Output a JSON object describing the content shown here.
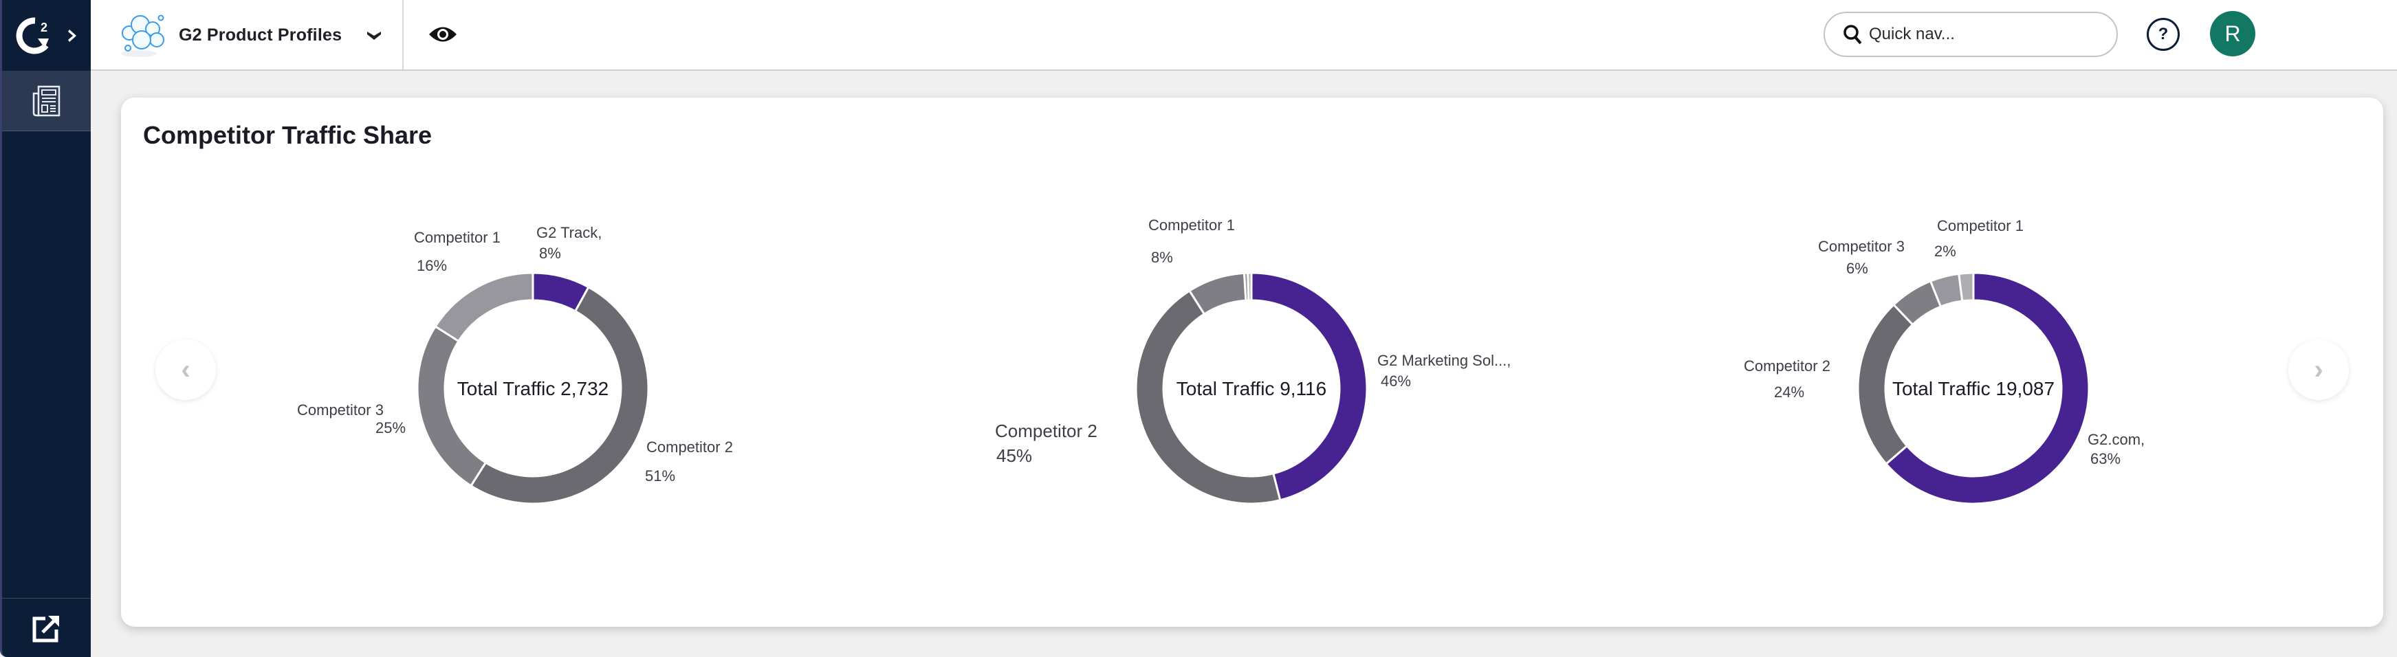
{
  "sidebar": {
    "logo_label": "G2",
    "expand_icon": "chevron-right-icon",
    "nav_items": [
      {
        "id": "reports",
        "icon": "newspaper-icon",
        "active": true
      }
    ],
    "footer_icon": "external-link-icon"
  },
  "header": {
    "product_name": "G2 Product Profiles",
    "product_icon": "cloud-logo-icon",
    "dropdown_icon": "chevron-down-icon",
    "view_icon": "eye-icon",
    "quick_nav_placeholder": "Quick nav...",
    "help_label": "?",
    "avatar_initial": "R"
  },
  "card": {
    "title": "Competitor Traffic Share",
    "prev_label": "‹",
    "next_label": "›"
  },
  "colors": {
    "brand_purple": "#472391",
    "competitor_dark": "#6b6a71",
    "competitor_mid": "#7f7e85",
    "competitor_light": "#98979d",
    "competitor_lighter": "#aeadb2",
    "avatar": "#127864",
    "sidebar": "#0c1e37"
  },
  "chart_data": [
    {
      "type": "pie",
      "variant": "donut",
      "center_label": "Total Traffic 2,732",
      "total": 2732,
      "slices": [
        {
          "name": "G2 Track,",
          "percent": 8,
          "label": "8%",
          "color": "#472391"
        },
        {
          "name": "Competitor 2",
          "percent": 51,
          "label": "51%",
          "color": "#6b6a71"
        },
        {
          "name": "Competitor 3",
          "percent": 25,
          "label": "25%",
          "color": "#7f7e85"
        },
        {
          "name": "Competitor 1",
          "percent": 16,
          "label": "16%",
          "color": "#98979d"
        }
      ]
    },
    {
      "type": "pie",
      "variant": "donut",
      "center_label": "Total Traffic 9,116",
      "total": 9116,
      "slices": [
        {
          "name": "G2 Marketing Sol...,",
          "percent": 46,
          "label": "46%",
          "color": "#472391"
        },
        {
          "name": "Competitor 2",
          "percent": 45,
          "label": "45%",
          "color": "#6b6a71"
        },
        {
          "name": "Competitor 1",
          "percent": 8,
          "label": "8%",
          "color": "#7f7e85"
        },
        {
          "name": "",
          "percent": 0.5,
          "label": "",
          "color": "#98979d"
        },
        {
          "name": "",
          "percent": 0.5,
          "label": "",
          "color": "#aeadb2"
        }
      ]
    },
    {
      "type": "pie",
      "variant": "donut",
      "center_label": "Total Traffic 19,087",
      "total": 19087,
      "slices": [
        {
          "name": "G2.com,",
          "percent": 63,
          "label": "63%",
          "color": "#472391"
        },
        {
          "name": "Competitor 2",
          "percent": 24,
          "label": "24%",
          "color": "#6b6a71"
        },
        {
          "name": "Competitor 3",
          "percent": 6,
          "label": "6%",
          "color": "#7f7e85"
        },
        {
          "name": "",
          "percent": 4,
          "label": "",
          "color": "#98979d"
        },
        {
          "name": "Competitor 1",
          "percent": 2,
          "label": "2%",
          "color": "#aeadb2"
        }
      ]
    }
  ]
}
